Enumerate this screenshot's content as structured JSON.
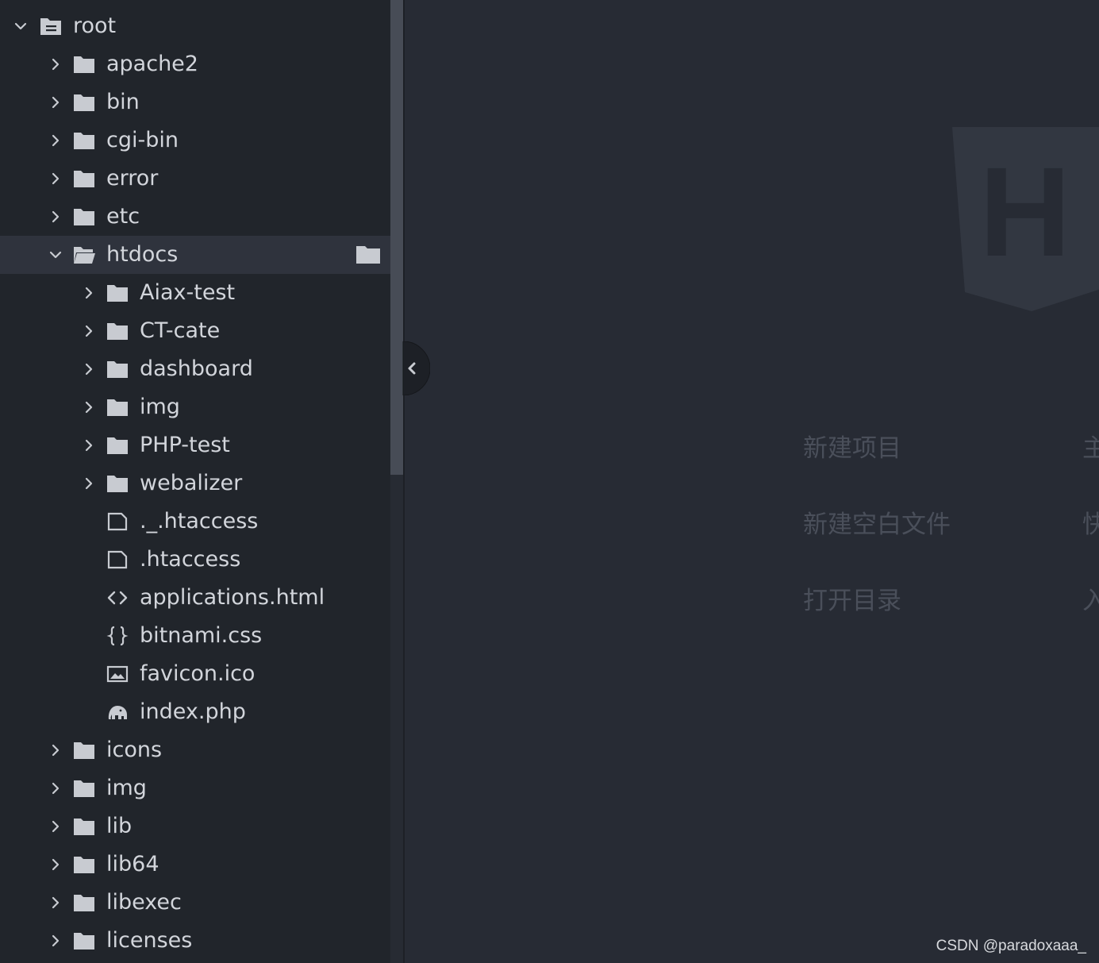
{
  "tree": {
    "root": {
      "label": "root",
      "icon": "root-folder-icon",
      "expanded": true
    },
    "items": [
      {
        "label": "apache2",
        "type": "folder",
        "expanded": false
      },
      {
        "label": "bin",
        "type": "folder",
        "expanded": false
      },
      {
        "label": "cgi-bin",
        "type": "folder",
        "expanded": false
      },
      {
        "label": "error",
        "type": "folder",
        "expanded": false
      },
      {
        "label": "etc",
        "type": "folder",
        "expanded": false
      },
      {
        "label": "htdocs",
        "type": "folder",
        "expanded": true,
        "selected": true
      },
      {
        "label": "Aiax-test",
        "type": "folder",
        "expanded": false
      },
      {
        "label": "CT-cate",
        "type": "folder",
        "expanded": false
      },
      {
        "label": "dashboard",
        "type": "folder",
        "expanded": false
      },
      {
        "label": "img",
        "type": "folder",
        "expanded": false
      },
      {
        "label": "PHP-test",
        "type": "folder",
        "expanded": false
      },
      {
        "label": "webalizer",
        "type": "folder",
        "expanded": false
      },
      {
        "label": "._.htaccess",
        "type": "file",
        "icon": "blank-file-icon"
      },
      {
        "label": ".htaccess",
        "type": "file",
        "icon": "blank-file-icon"
      },
      {
        "label": "applications.html",
        "type": "file",
        "icon": "html-code-icon"
      },
      {
        "label": "bitnami.css",
        "type": "file",
        "icon": "css-braces-icon"
      },
      {
        "label": "favicon.ico",
        "type": "file",
        "icon": "image-file-icon"
      },
      {
        "label": "index.php",
        "type": "file",
        "icon": "php-elephant-icon"
      },
      {
        "label": "icons",
        "type": "folder",
        "expanded": false
      },
      {
        "label": "img",
        "type": "folder",
        "expanded": false
      },
      {
        "label": "lib",
        "type": "folder",
        "expanded": false
      },
      {
        "label": "lib64",
        "type": "folder",
        "expanded": false
      },
      {
        "label": "libexec",
        "type": "folder",
        "expanded": false
      },
      {
        "label": "licenses",
        "type": "folder",
        "expanded": false
      }
    ]
  },
  "welcome": {
    "logo_letter": "H",
    "menu_left": [
      "新建项目",
      "新建空白文件",
      "打开目录"
    ],
    "menu_right_partial": [
      "主",
      "快",
      "入"
    ]
  },
  "watermark": "CSDN @paradoxaaa_",
  "colors": {
    "sidebar_bg": "#21252b",
    "editor_bg": "#272b34",
    "selected_row": "#2f333d",
    "text": "#d2d5db",
    "muted_menu": "#4a4f5a"
  }
}
